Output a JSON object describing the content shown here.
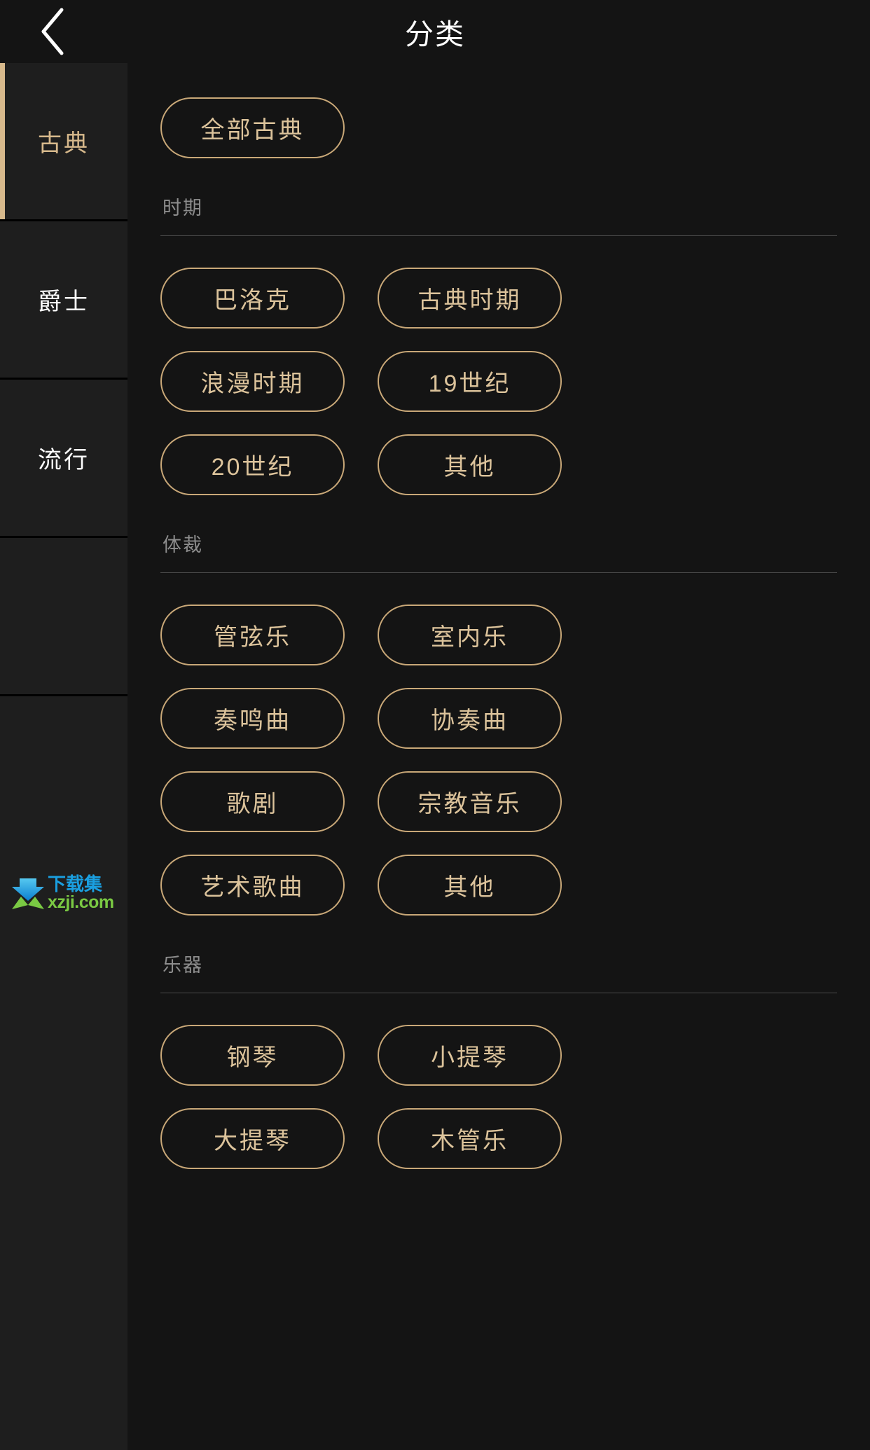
{
  "header": {
    "title": "分类",
    "back_icon": "chevron-left-icon"
  },
  "sidebar": {
    "items": [
      {
        "label": "古典",
        "selected": true
      },
      {
        "label": "爵士",
        "selected": false
      },
      {
        "label": "流行",
        "selected": false
      },
      {
        "label": "",
        "selected": false
      }
    ]
  },
  "watermark": {
    "brand": "下载集",
    "url": "xzji.com",
    "logo_icon": "xzji-arrow-logo-icon",
    "brand_color": "#1a9fe0",
    "url_color": "#7ac943"
  },
  "colors": {
    "accent_gold": "#c9a878",
    "accent_gold_text": "#dcc39b",
    "background": "#141414",
    "sidebar_background": "#1e1e1e",
    "header_background": "#141414",
    "section_label": "#8d8d8d",
    "divider": "#4a4a4a"
  },
  "main": {
    "all_pill": {
      "label": "全部古典"
    },
    "sections": [
      {
        "label": "时期",
        "options": [
          {
            "label": "巴洛克"
          },
          {
            "label": "古典时期"
          },
          {
            "label": "浪漫时期"
          },
          {
            "label": "19世纪"
          },
          {
            "label": "20世纪"
          },
          {
            "label": "其他"
          }
        ]
      },
      {
        "label": "体裁",
        "options": [
          {
            "label": "管弦乐"
          },
          {
            "label": "室内乐"
          },
          {
            "label": "奏鸣曲"
          },
          {
            "label": "协奏曲"
          },
          {
            "label": "歌剧"
          },
          {
            "label": "宗教音乐"
          },
          {
            "label": "艺术歌曲"
          },
          {
            "label": "其他"
          }
        ]
      },
      {
        "label": "乐器",
        "options": [
          {
            "label": "钢琴"
          },
          {
            "label": "小提琴"
          },
          {
            "label": "大提琴"
          },
          {
            "label": "木管乐"
          }
        ]
      }
    ]
  }
}
